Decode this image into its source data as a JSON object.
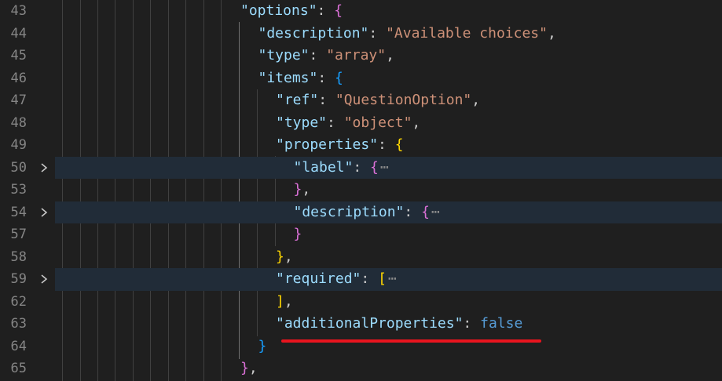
{
  "editor": {
    "lines": [
      {
        "num": "43",
        "folded": false,
        "indent": 0,
        "tokens": [
          [
            "k",
            "\"options\""
          ],
          [
            "p",
            ": "
          ],
          [
            "b1",
            "{"
          ]
        ]
      },
      {
        "num": "44",
        "folded": false,
        "indent": 1,
        "tokens": [
          [
            "k",
            "\"description\""
          ],
          [
            "p",
            ": "
          ],
          [
            "s",
            "\"Available choices\""
          ],
          [
            "p",
            ","
          ]
        ]
      },
      {
        "num": "45",
        "folded": false,
        "indent": 1,
        "tokens": [
          [
            "k",
            "\"type\""
          ],
          [
            "p",
            ": "
          ],
          [
            "s",
            "\"array\""
          ],
          [
            "p",
            ","
          ]
        ]
      },
      {
        "num": "46",
        "folded": false,
        "indent": 1,
        "tokens": [
          [
            "k",
            "\"items\""
          ],
          [
            "p",
            ": "
          ],
          [
            "b2",
            "{"
          ]
        ]
      },
      {
        "num": "47",
        "folded": false,
        "indent": 2,
        "tokens": [
          [
            "k",
            "\"ref\""
          ],
          [
            "p",
            ": "
          ],
          [
            "s",
            "\"QuestionOption\""
          ],
          [
            "p",
            ","
          ]
        ]
      },
      {
        "num": "48",
        "folded": false,
        "indent": 2,
        "tokens": [
          [
            "k",
            "\"type\""
          ],
          [
            "p",
            ": "
          ],
          [
            "s",
            "\"object\""
          ],
          [
            "p",
            ","
          ]
        ]
      },
      {
        "num": "49",
        "folded": false,
        "indent": 2,
        "tokens": [
          [
            "k",
            "\"properties\""
          ],
          [
            "p",
            ": "
          ],
          [
            "b3",
            "{"
          ]
        ]
      },
      {
        "num": "50",
        "folded": true,
        "indent": 3,
        "tokens": [
          [
            "k",
            "\"label\""
          ],
          [
            "p",
            ": "
          ],
          [
            "b1",
            "{"
          ],
          [
            "dots",
            "⋯"
          ]
        ]
      },
      {
        "num": "53",
        "folded": false,
        "indent": 3,
        "tokens": [
          [
            "b1",
            "}"
          ],
          [
            "p",
            ","
          ]
        ]
      },
      {
        "num": "54",
        "folded": true,
        "indent": 3,
        "tokens": [
          [
            "k",
            "\"description\""
          ],
          [
            "p",
            ": "
          ],
          [
            "b1",
            "{"
          ],
          [
            "dots",
            "⋯"
          ]
        ]
      },
      {
        "num": "57",
        "folded": false,
        "indent": 3,
        "tokens": [
          [
            "b1",
            "}"
          ]
        ]
      },
      {
        "num": "58",
        "folded": false,
        "indent": 2,
        "tokens": [
          [
            "b3",
            "}"
          ],
          [
            "p",
            ","
          ]
        ]
      },
      {
        "num": "59",
        "folded": true,
        "indent": 2,
        "tokens": [
          [
            "k",
            "\"required\""
          ],
          [
            "p",
            ": "
          ],
          [
            "b3",
            "["
          ],
          [
            "dots",
            "⋯"
          ]
        ]
      },
      {
        "num": "62",
        "folded": false,
        "indent": 2,
        "tokens": [
          [
            "b3",
            "]"
          ],
          [
            "p",
            ","
          ]
        ]
      },
      {
        "num": "63",
        "folded": false,
        "indent": 2,
        "tokens": [
          [
            "k",
            "\"additionalProperties\""
          ],
          [
            "p",
            ": "
          ],
          [
            "kw",
            "false"
          ]
        ]
      },
      {
        "num": "64",
        "folded": false,
        "indent": 1,
        "tokens": [
          [
            "b2",
            "}"
          ]
        ]
      },
      {
        "num": "65",
        "folded": false,
        "indent": 0,
        "tokens": [
          [
            "b1",
            "}"
          ],
          [
            "p",
            ","
          ]
        ]
      }
    ]
  },
  "colors": {
    "background": "#1f1f1f",
    "folded_line_bg": "#212c38",
    "annotation_underline": "#e8141e"
  }
}
